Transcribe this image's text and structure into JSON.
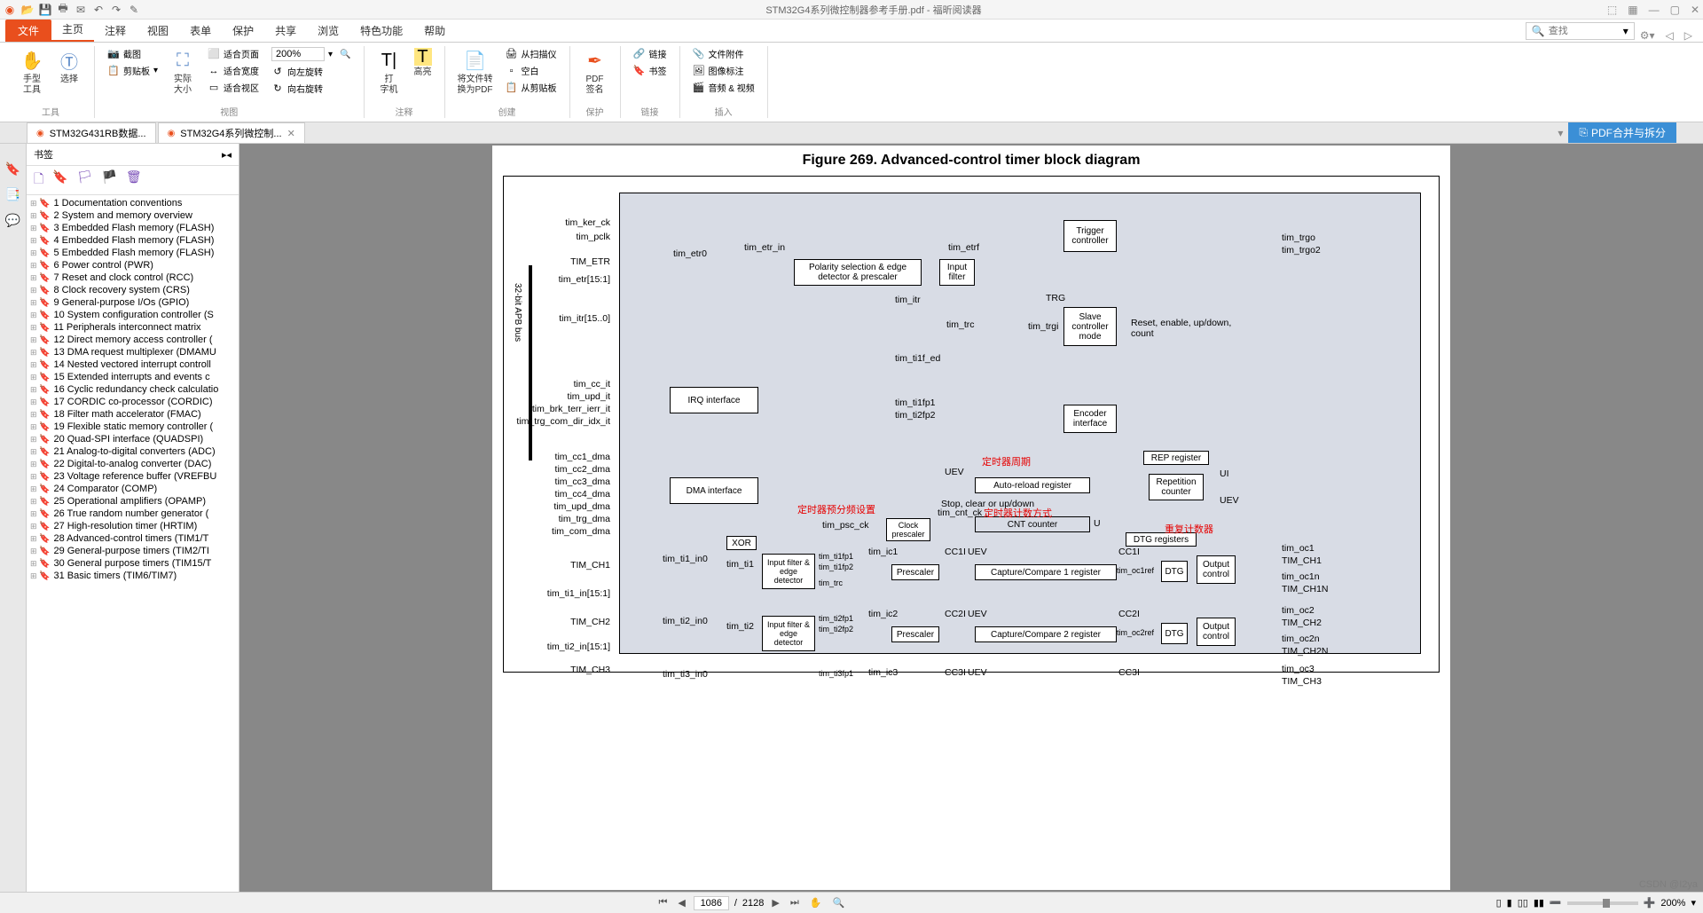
{
  "window": {
    "title": "STM32G4系列微控制器参考手册.pdf - 福昕阅读器"
  },
  "menu": {
    "file": "文件",
    "items": [
      "主页",
      "注释",
      "视图",
      "表单",
      "保护",
      "共享",
      "浏览",
      "特色功能",
      "帮助"
    ],
    "search_placeholder": "查找"
  },
  "ribbon": {
    "groups": {
      "tools": {
        "label": "工具",
        "hand_tool": "手型\n工具",
        "select": "选择"
      },
      "view": {
        "label": "视图",
        "snapshot": "截图",
        "clipboard": "剪贴板",
        "actual_size": "实际\n大小",
        "fit_page": "适合页面",
        "fit_width": "适合宽度",
        "fit_visible": "适合视区",
        "zoom_value": "200%",
        "rotate_left": "向左旋转",
        "rotate_right": "向右旋转"
      },
      "annot": {
        "label": "注释",
        "typewriter": "打\n字机",
        "highlight": "高亮"
      },
      "create": {
        "label": "创建",
        "to_pdf": "将文件转\n换为PDF",
        "from_scan": "从扫描仪",
        "blank": "空白",
        "from_clip": "从剪贴板"
      },
      "protect": {
        "label": "保护",
        "sign": "PDF\n签名"
      },
      "links": {
        "label": "链接",
        "link": "链接",
        "bookmark": "书签"
      },
      "insert": {
        "label": "插入",
        "attach": "文件附件",
        "image_mark": "图像标注",
        "av": "音频 & 视频"
      }
    }
  },
  "tabs": {
    "tab1": "STM32G431RB数据...",
    "tab2": "STM32G4系列微控制...",
    "merge": "PDF合并与拆分"
  },
  "bookmarks": {
    "title": "书签",
    "items": [
      "1 Documentation conventions",
      "2 System and memory overview",
      "3 Embedded Flash memory (FLASH)",
      "4 Embedded Flash memory (FLASH)",
      "5 Embedded Flash memory (FLASH)",
      "6 Power control (PWR)",
      "7 Reset and clock control (RCC)",
      "8 Clock recovery system (CRS)",
      "9 General-purpose I/Os (GPIO)",
      "10 System configuration controller (S",
      "11 Peripherals interconnect matrix",
      "12 Direct memory access controller (",
      "13 DMA request multiplexer (DMAMU",
      "14 Nested vectored interrupt controll",
      "15 Extended interrupts and events c",
      "16 Cyclic redundancy check calculatio",
      "17 CORDIC co-processor (CORDIC)",
      "18 Filter math accelerator (FMAC)",
      "19 Flexible static memory controller (",
      "20 Quad-SPI interface (QUADSPI)",
      "21 Analog-to-digital converters (ADC)",
      "22 Digital-to-analog converter (DAC)",
      "23 Voltage reference buffer (VREFBU",
      "24 Comparator (COMP)",
      "25 Operational amplifiers (OPAMP)",
      "26 True random number generator (",
      "27 High-resolution timer (HRTIM)",
      "28 Advanced-control timers (TIM1/T",
      "29 General-purpose timers (TIM2/TI",
      "30 General purpose timers (TIM15/T",
      "31 Basic timers (TIM6/TIM7)"
    ]
  },
  "page": {
    "fig_title": "Figure 269. Advanced-control timer block diagram",
    "apb_label": "32-bit APB\nbus",
    "signals_left": {
      "tim_ker_ck": "tim_ker_ck",
      "tim_pclk": "tim_pclk",
      "tim_etr_cap": "TIM_ETR",
      "tim_etr15": "tim_etr[15:1]",
      "tim_itr15": "tim_itr[15..0]",
      "tim_cc_it": "tim_cc_it",
      "tim_upd_it": "tim_upd_it",
      "tim_brk": "tim_brk_terr_ierr_it",
      "tim_trg_it": "tim_trg_com_dir_idx_it",
      "tim_cc1_dma": "tim_cc1_dma",
      "tim_cc2_dma": "tim_cc2_dma",
      "tim_cc3_dma": "tim_cc3_dma",
      "tim_cc4_dma": "tim_cc4_dma",
      "tim_upd_dma": "tim_upd_dma",
      "tim_trg_dma": "tim_trg_dma",
      "tim_com_dma": "tim_com_dma",
      "tim_ch1": "TIM_CH1",
      "tim_ti1_in15": "tim_ti1_in[15:1]",
      "tim_ch2": "TIM_CH2",
      "tim_ti2_in15": "tim_ti2_in[15:1]",
      "tim_ch3": "TIM_CH3"
    },
    "signals_mid": {
      "tim_etr0": "tim_etr0",
      "tim_etr_in": "tim_etr_in",
      "tim_etrf": "tim_etrf",
      "tim_itr": "tim_itr",
      "tim_trc": "tim_trc",
      "tim_ti1f_ed": "tim_ti1f_ed",
      "tim_ti1fp1": "tim_ti1fp1",
      "tim_ti2fp2": "tim_ti2fp2",
      "trg": "TRG",
      "tim_trgi": "tim_trgi",
      "tim_ti1_in0": "tim_ti1_in0",
      "tim_ti1": "tim_ti1",
      "tim_ti2_in0": "tim_ti2_in0",
      "tim_ti2": "tim_ti2",
      "tim_ti3_in0": "tim_ti3_in0",
      "tim_ti1fp1b": "tim_ti1fp1",
      "tim_ti1fp2": "tim_ti1fp2",
      "tim_trc2": "tim_trc",
      "tim_ti2fp1": "tim_ti2fp1",
      "tim_ti2fp2b": "tim_ti2fp2",
      "tim_ti3fp1": "tim_ti3fp1",
      "tim_ic1": "tim_ic1",
      "tim_ic2": "tim_ic2",
      "tim_ic3": "tim_ic3",
      "tim_psc_ck": "tim_psc_ck",
      "tim_cnt_ck": "tim_cnt_ck",
      "uev": "UEV",
      "stop": "Stop, clear or up/down",
      "cc1i": "CC1I",
      "cc2i": "CC2I",
      "cc3i": "CC3I",
      "u": "U",
      "ui": "UI",
      "cc1ib": "CC1I",
      "cc2ib": "CC2I",
      "cc3ib": "CC3I",
      "tim_oc1ref": "tim_oc1ref",
      "tim_oc2ref": "tim_oc2ref"
    },
    "signals_right": {
      "tim_trgo": "tim_trgo",
      "tim_trgo2": "tim_trgo2",
      "reset_enable": "Reset, enable, up/down,\ncount",
      "tim_oc1": "tim_oc1",
      "tim_ch1_out": "TIM_CH1",
      "tim_oc1n": "tim_oc1n",
      "tim_ch1n": "TIM_CH1N",
      "tim_oc2": "tim_oc2",
      "tim_ch2_out": "TIM_CH2",
      "tim_oc2n": "tim_oc2n",
      "tim_ch2n": "TIM_CH2N",
      "tim_oc3": "tim_oc3",
      "tim_ch3_out": "TIM_CH3"
    },
    "boxes": {
      "trigger_ctrl": "Trigger\ncontroller",
      "polarity": "Polarity selection & edge\ndetector & prescaler",
      "input_filter": "Input\nfilter",
      "slave": "Slave\ncontroller\nmode",
      "encoder": "Encoder\ninterface",
      "irq": "IRQ interface",
      "dma": "DMA interface",
      "xor": "XOR",
      "inp_filter_edge": "Input filter\n& edge\ndetector",
      "inp_filter_edge2": "Input filter\n& edge\ndetector",
      "prescaler1": "Prescaler",
      "prescaler2": "Prescaler",
      "clock_prescaler": "Clock\nprescaler",
      "auto_reload": "Auto-reload register",
      "rep_reg": "REP register",
      "rep_cnt": "Repetition\ncounter",
      "dtg_reg": "DTG registers",
      "cc1": "Capture/Compare 1 register",
      "cc2": "Capture/Compare 2 register",
      "dtg1": "DTG",
      "dtg2": "DTG",
      "out_ctrl1": "Output\ncontrol",
      "out_ctrl2": "Output\ncontrol",
      "cnt": "CNT counter"
    },
    "annotations": {
      "a1": "定时器预分频设置",
      "a2": "定时器周期",
      "a3": "定时器计数方式",
      "a4": "重复计数器"
    }
  },
  "status": {
    "current_page": "1086",
    "total_pages": "2128",
    "sep": " / ",
    "zoom": "200%"
  },
  "watermark": "CSDN @I2ya"
}
